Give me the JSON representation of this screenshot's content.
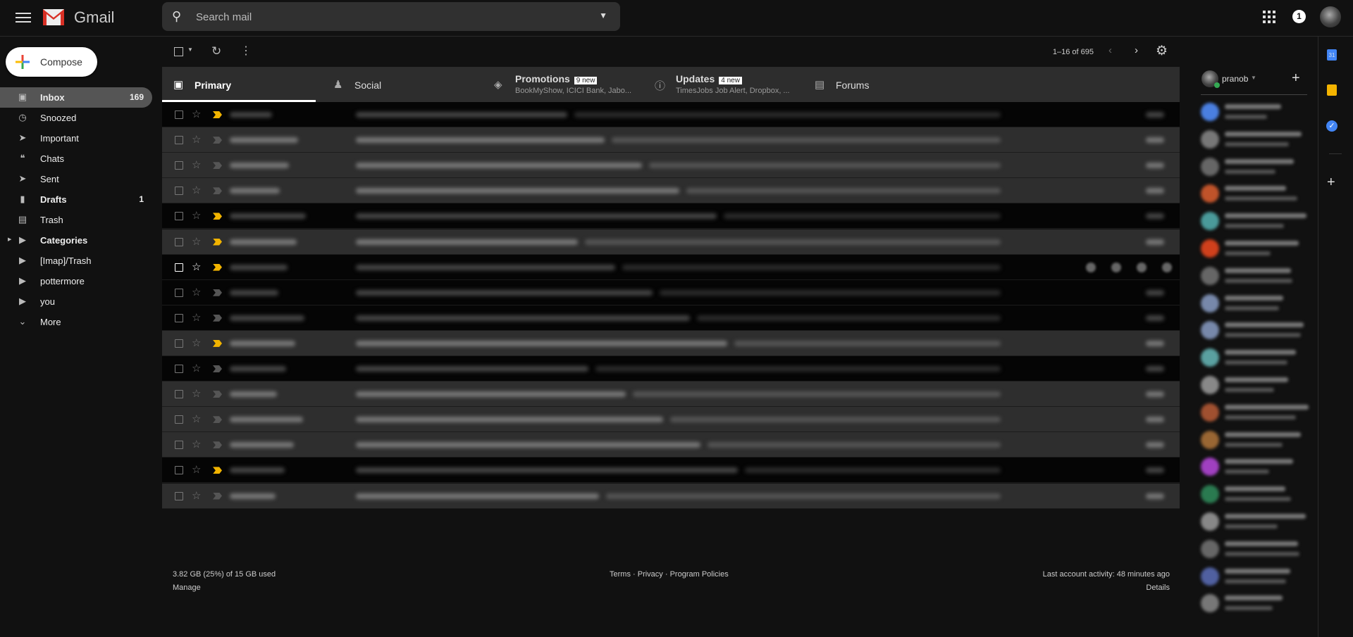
{
  "header": {
    "app_name": "Gmail",
    "search_placeholder": "Search mail",
    "notification_count": "1"
  },
  "compose_label": "Compose",
  "sidebar": {
    "items": [
      {
        "label": "Inbox",
        "count": "169",
        "icon": "inbox-icon",
        "bold": true,
        "active": true
      },
      {
        "label": "Snoozed",
        "count": "",
        "icon": "clock-icon"
      },
      {
        "label": "Important",
        "count": "",
        "icon": "important-icon"
      },
      {
        "label": "Chats",
        "count": "",
        "icon": "chat-icon"
      },
      {
        "label": "Sent",
        "count": "",
        "icon": "send-icon"
      },
      {
        "label": "Drafts",
        "count": "1",
        "icon": "draft-icon",
        "bold": true
      },
      {
        "label": "Trash",
        "count": "",
        "icon": "trash-icon"
      },
      {
        "label": "Categories",
        "count": "",
        "icon": "label-icon",
        "bold": true
      },
      {
        "label": "[Imap]/Trash",
        "count": "",
        "icon": "label-icon"
      },
      {
        "label": "pottermore",
        "count": "",
        "icon": "label-icon"
      },
      {
        "label": "you",
        "count": "",
        "icon": "label-icon"
      },
      {
        "label": "More",
        "count": "",
        "icon": "chevron-down-icon"
      }
    ]
  },
  "toolbar": {
    "pagination": "1–16 of 695"
  },
  "tabs": [
    {
      "label": "Primary",
      "icon": "inbox-icon",
      "badge": "",
      "sub": ""
    },
    {
      "label": "Social",
      "icon": "people-icon",
      "badge": "",
      "sub": ""
    },
    {
      "label": "Promotions",
      "icon": "tag-icon",
      "badge": "9 new",
      "sub": "BookMyShow, ICICI Bank, Jabo..."
    },
    {
      "label": "Updates",
      "icon": "info-icon",
      "badge": "4 new",
      "sub": "TimesJobs Job Alert, Dropbox, ..."
    },
    {
      "label": "Forums",
      "icon": "forum-icon",
      "badge": "",
      "sub": ""
    }
  ],
  "emails": [
    {
      "unread": false,
      "important": true
    },
    {
      "unread": true,
      "important": false
    },
    {
      "unread": true,
      "important": false
    },
    {
      "unread": true,
      "important": false
    },
    {
      "unread": false,
      "important": true
    },
    {
      "unread": true,
      "important": true
    },
    {
      "unread": false,
      "important": true,
      "hover": true
    },
    {
      "unread": false,
      "important": false
    },
    {
      "unread": false,
      "important": false
    },
    {
      "unread": true,
      "important": true
    },
    {
      "unread": false,
      "important": false
    },
    {
      "unread": true,
      "important": false
    },
    {
      "unread": true,
      "important": false
    },
    {
      "unread": true,
      "important": false
    },
    {
      "unread": false,
      "important": true
    },
    {
      "unread": true,
      "important": false
    }
  ],
  "chat": {
    "user": "pranob",
    "status_color": "#34a853"
  },
  "footer": {
    "storage": "3.82 GB (25%) of 15 GB used",
    "manage": "Manage",
    "terms": "Terms",
    "privacy": "Privacy",
    "policies": "Program Policies",
    "activity": "Last account activity: 48 minutes ago",
    "details": "Details"
  },
  "colors": {
    "important": "#f2b400",
    "calendar": "#4285f4",
    "keep": "#f4b400",
    "tasks": "#4285f4"
  }
}
